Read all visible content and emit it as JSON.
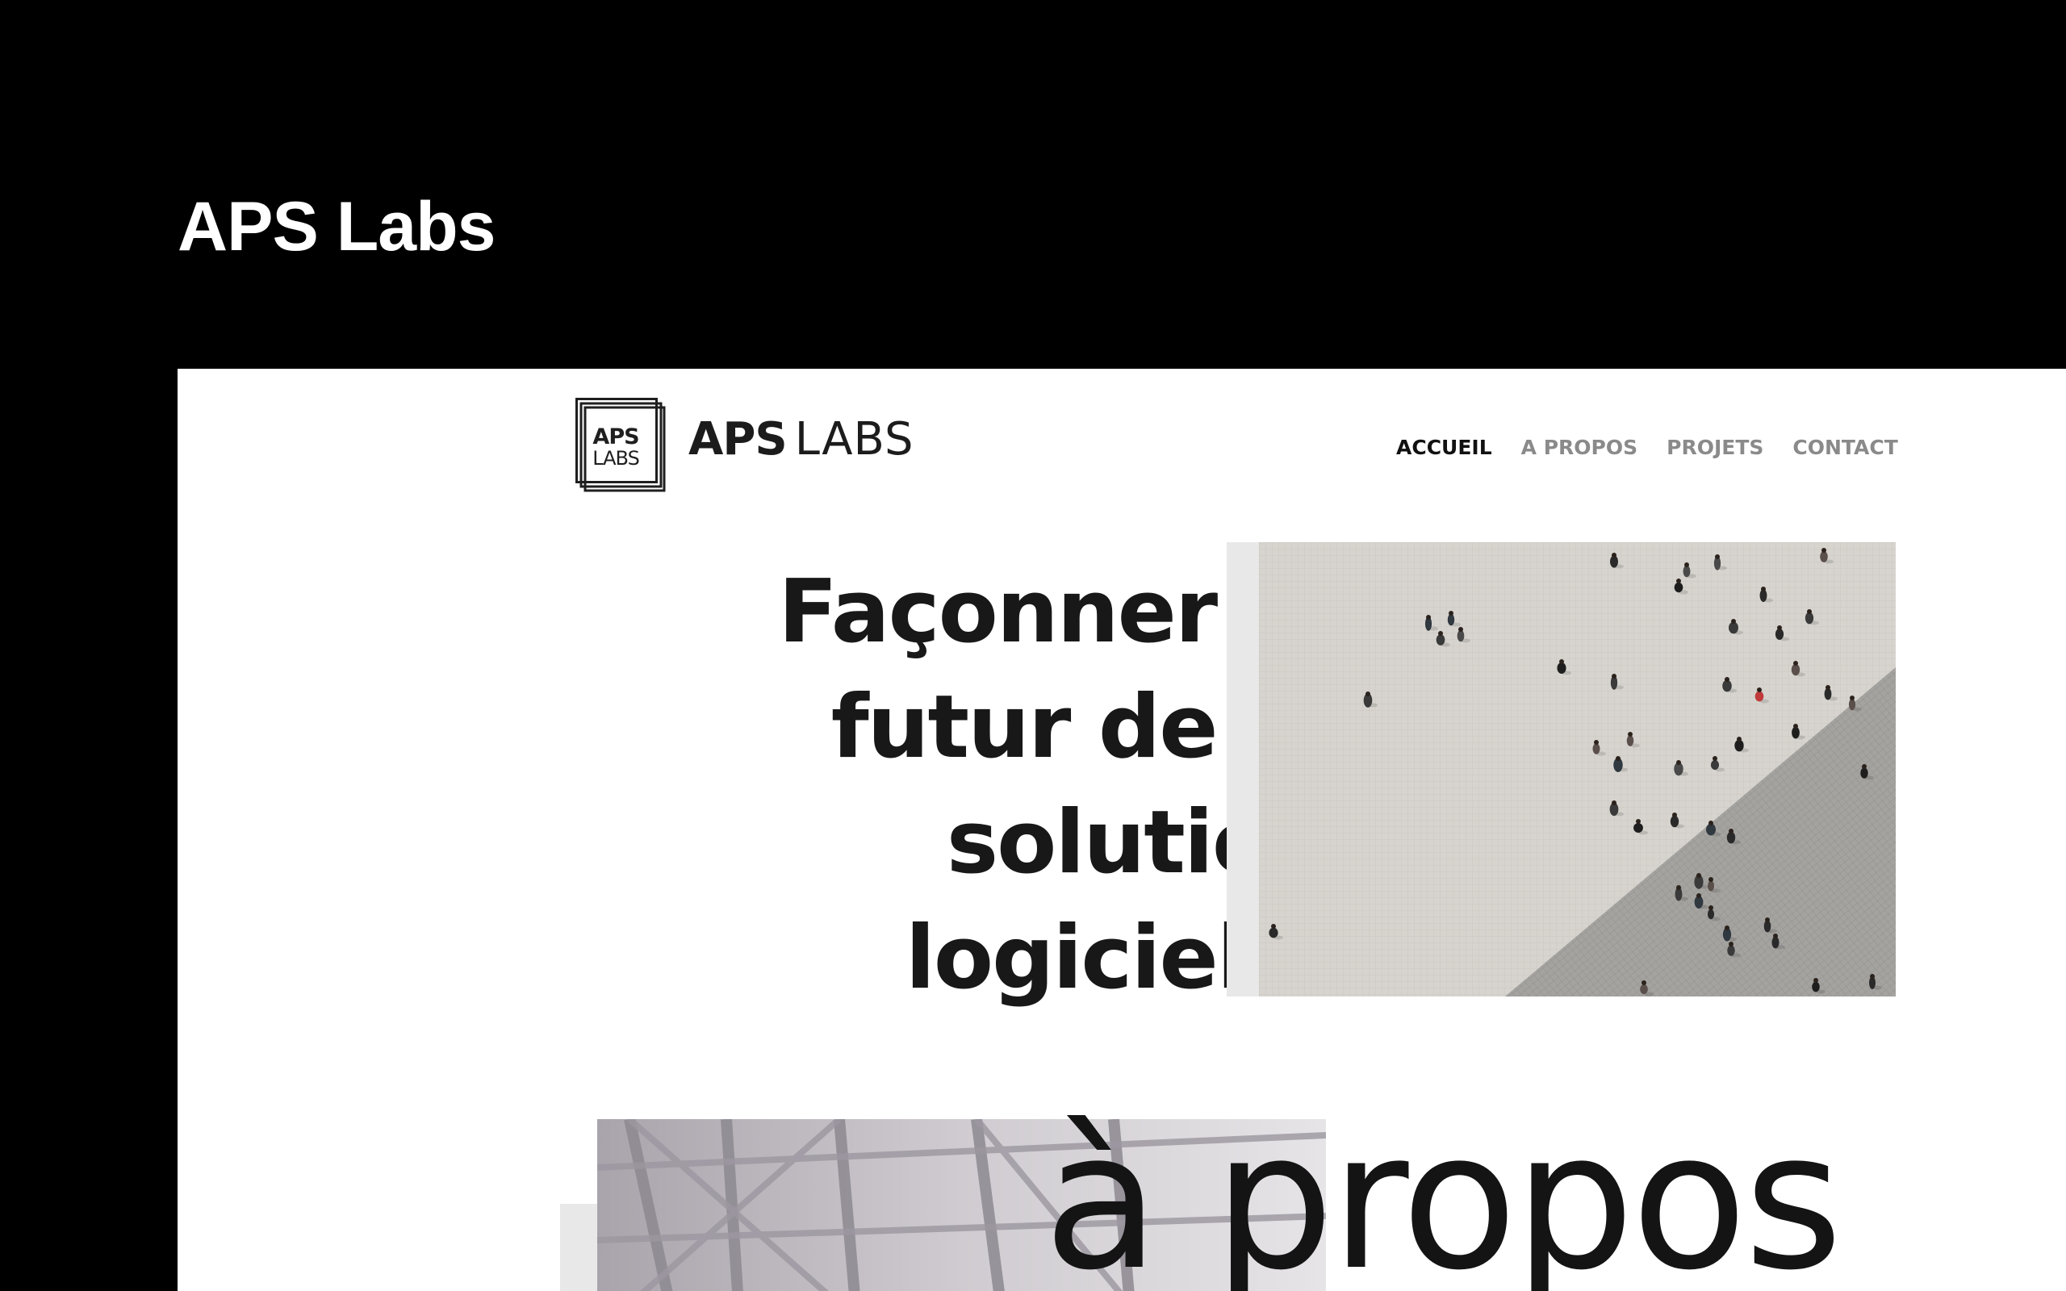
{
  "frame": {
    "title": "APS Labs"
  },
  "header": {
    "logo_mark": {
      "line1": "APS",
      "line2": "LABS"
    },
    "brand": {
      "strong": "APS",
      "light": "LABS"
    },
    "nav": [
      {
        "label": "ACCUEIL",
        "active": true
      },
      {
        "label": "A PROPOS",
        "active": false
      },
      {
        "label": "PROJETS",
        "active": false
      },
      {
        "label": "CONTACT",
        "active": false
      }
    ]
  },
  "hero": {
    "heading_lines": [
      "Façonner le",
      "futur de la",
      "solution",
      "logicielle"
    ],
    "image_icon": "aerial-crowd-photo"
  },
  "about": {
    "heading": "à propos",
    "image_icon": "glass-building-photo"
  },
  "colors": {
    "frame_background": "#000000",
    "page_background": "#ffffff",
    "text_dark": "#181818",
    "nav_inactive": "#8a8a8a",
    "panel_gray": "#e8e8e8"
  }
}
